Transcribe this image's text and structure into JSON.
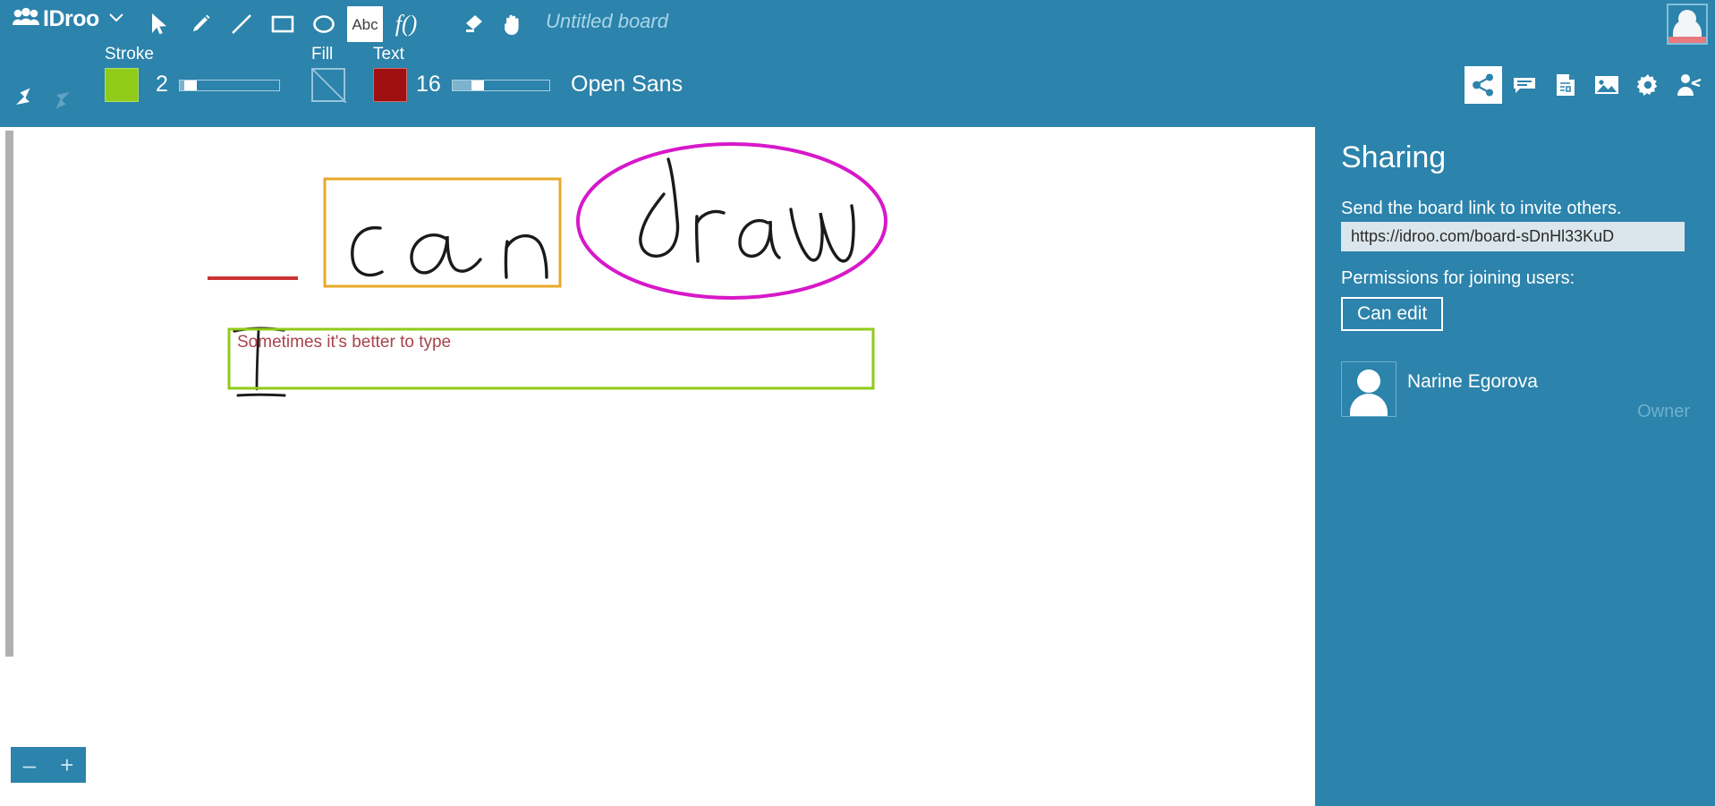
{
  "app": {
    "brand": "IDroo",
    "brand_caret_icon": "chevron-down-icon",
    "board_title": "Untitled board"
  },
  "toolbar": {
    "tools": [
      {
        "name": "select-tool",
        "icon": "cursor-arrow-icon",
        "label": "",
        "active": false
      },
      {
        "name": "pencil-tool",
        "icon": "pencil-icon",
        "label": "",
        "active": false
      },
      {
        "name": "line-tool",
        "icon": "line-icon",
        "label": "",
        "active": false
      },
      {
        "name": "rectangle-tool",
        "icon": "rectangle-icon",
        "label": "",
        "active": false
      },
      {
        "name": "ellipse-tool",
        "icon": "ellipse-icon",
        "label": "",
        "active": false
      },
      {
        "name": "text-tool",
        "icon": "abc-icon",
        "label": "Abc",
        "active": true
      },
      {
        "name": "formula-tool",
        "icon": "function-icon",
        "label": "f()",
        "active": false
      },
      {
        "name": "eraser-tool",
        "icon": "eraser-icon",
        "label": "",
        "active": false
      },
      {
        "name": "pan-tool",
        "icon": "hand-icon",
        "label": "",
        "active": false
      }
    ]
  },
  "properties": {
    "undo_icon": "undo-arrow-icon",
    "redo_icon": "redo-arrow-icon",
    "stroke_label": "Stroke",
    "stroke_color": "#8fcb18",
    "stroke_size": "2",
    "fill_label": "Fill",
    "fill_color": "none",
    "text_label": "Text",
    "text_color": "#a01010",
    "text_size": "16",
    "font_name": "Open Sans"
  },
  "right_icons": [
    {
      "name": "share-icon",
      "active": true
    },
    {
      "name": "chat-icon",
      "active": false
    },
    {
      "name": "document-icon",
      "active": false
    },
    {
      "name": "image-icon",
      "active": false
    },
    {
      "name": "gear-icon",
      "active": false
    },
    {
      "name": "presenter-icon",
      "active": false
    }
  ],
  "canvas": {
    "handwriting": "I can draw",
    "typed_text": "Sometimes it's better to type",
    "typed_text_color": "#a8434a",
    "underline_color": "#cc3333",
    "rectangle_color": "#e8a828",
    "ellipse_color": "#d718c9",
    "textbox_border_color": "#8fcb18",
    "zoom_out_label": "–",
    "zoom_in_label": "+"
  },
  "panel": {
    "title": "Sharing",
    "subtitle": "Send the board link to invite others.",
    "board_link": "https://idroo.com/board-sDnHl33KuD",
    "permissions_label": "Permissions for joining users:",
    "permission_value": "Can edit",
    "members": [
      {
        "name": "Narine Egorova",
        "role": "Owner"
      }
    ]
  }
}
